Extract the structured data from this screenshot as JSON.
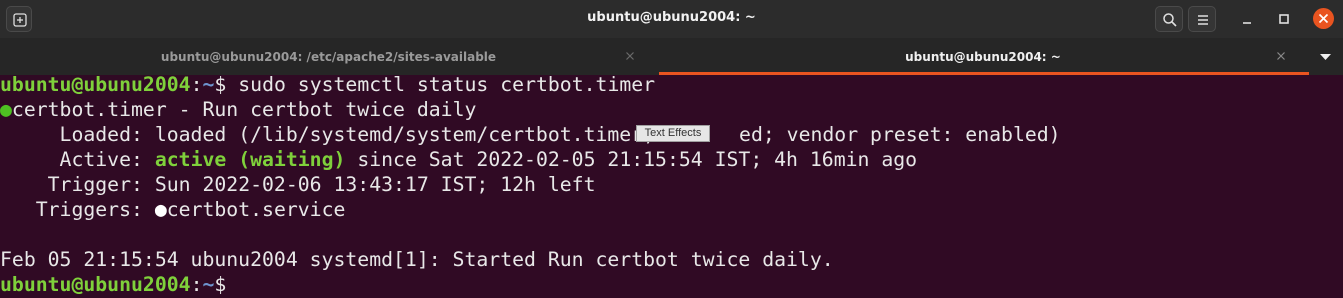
{
  "window": {
    "title": "ubuntu@ubunu2004: ~",
    "accent_color": "#e95420",
    "background_color": "#300a24",
    "controls": [
      "new-tab-icon",
      "search-icon",
      "hamburger-menu-icon",
      "minimize-icon",
      "maximize-icon",
      "close-icon"
    ]
  },
  "tabs": [
    {
      "label": "ubuntu@ubunu2004: /etc/apache2/sites-available",
      "active": false
    },
    {
      "label": "ubuntu@ubunu2004: ~",
      "active": true
    }
  ],
  "terminal": {
    "prompt": {
      "user_host": "ubuntu@ubunu2004",
      "path": "~",
      "symbol": "$"
    },
    "command": "sudo systemctl status certbot.timer",
    "status": {
      "header": "certbot.timer - Run certbot twice daily",
      "loaded_label": "     Loaded:",
      "loaded_value_before": " loaded (/lib/systemd/system/certbot.timer;",
      "loaded_value_after": "ed; vendor preset: enabled)",
      "active_label": "     Active:",
      "active_state": "active (waiting)",
      "active_rest": " since Sat 2022-02-05 21:15:54 IST; 4h 16min ago",
      "trigger_label": "    Trigger:",
      "trigger_value": " Sun 2022-02-06 13:43:17 IST; 12h left",
      "triggers_label": "   Triggers:",
      "triggers_value": "certbot.service"
    },
    "log_line": "Feb 05 21:15:54 ubunu2004 systemd[1]: Started Run certbot twice daily.",
    "dot_glyph": "●",
    "status_colors": {
      "active": "#7fd13b",
      "dot": "#4ec022"
    }
  },
  "tooltip": {
    "text": "Text Effects"
  }
}
